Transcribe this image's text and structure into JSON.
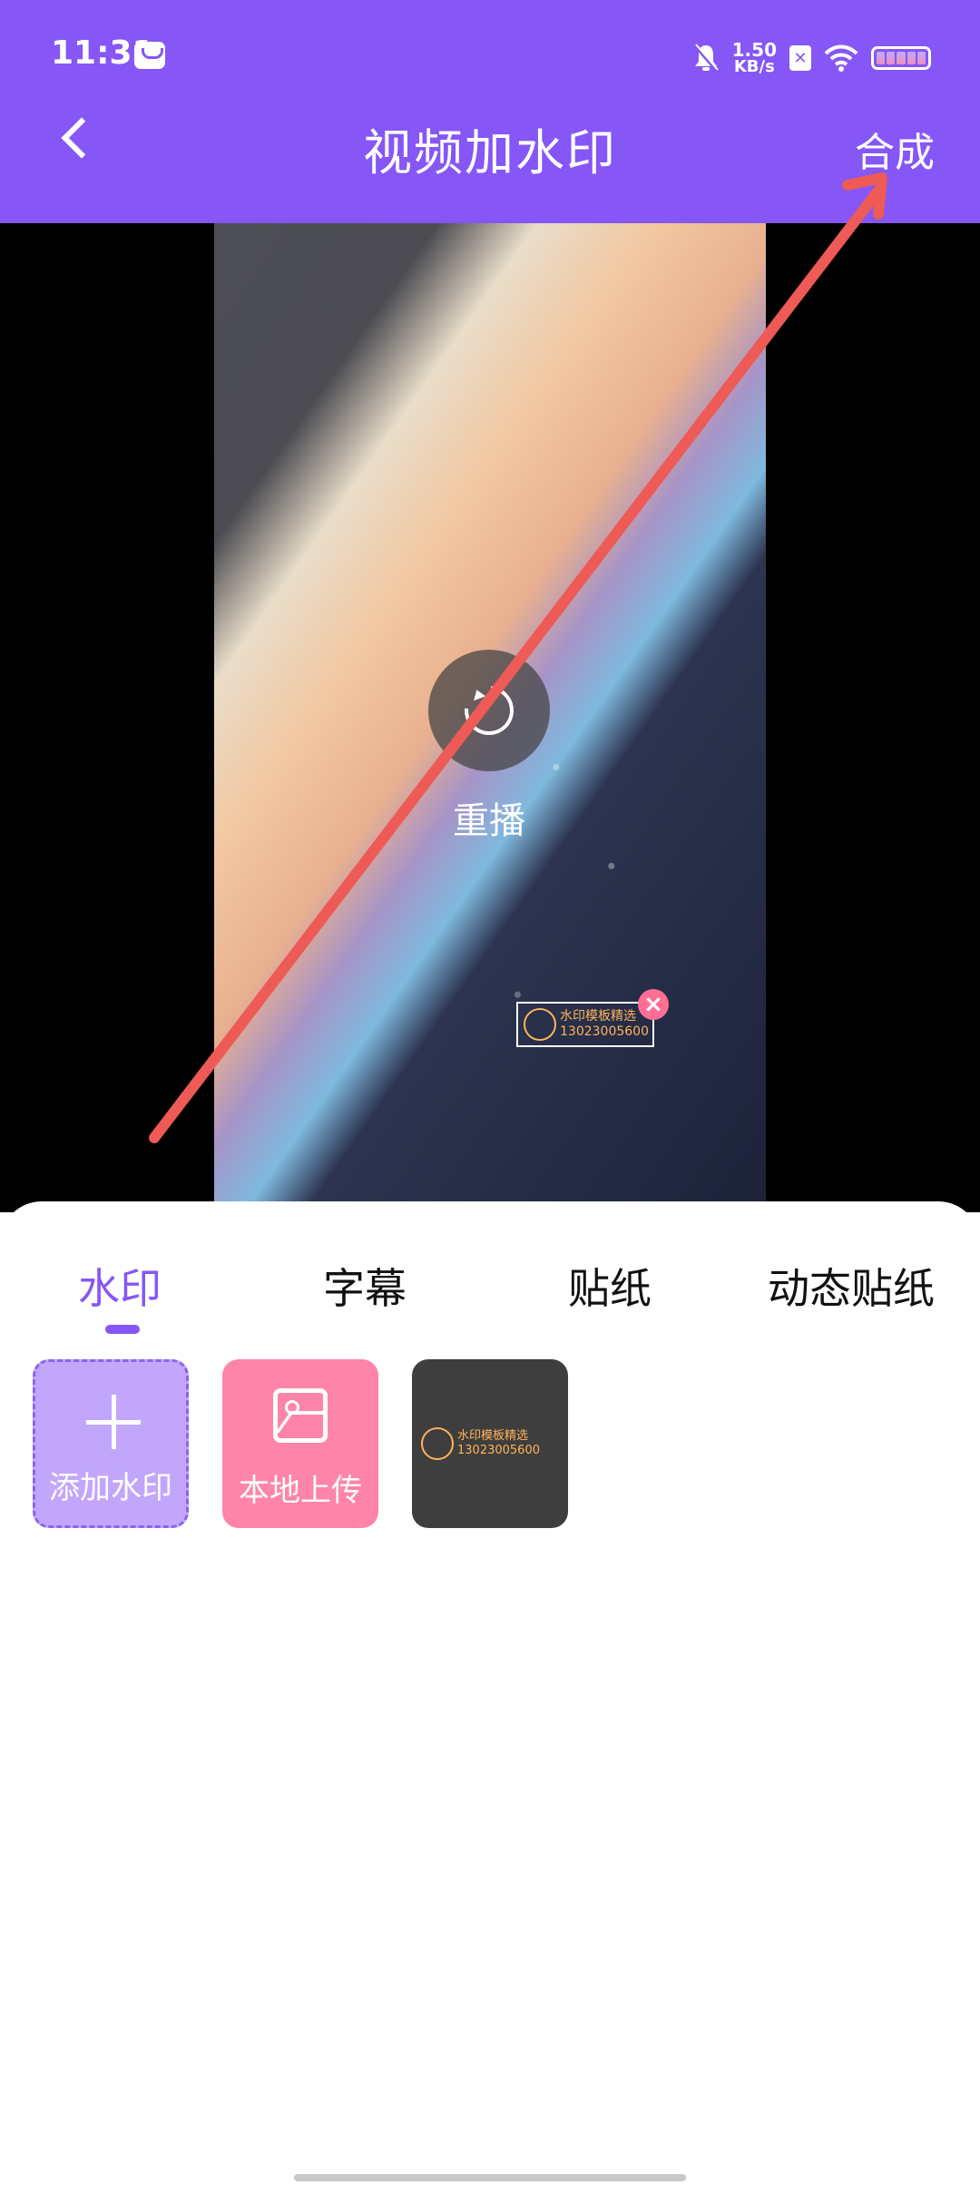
{
  "status_bar": {
    "time": "11:31",
    "net_speed_value": "1.50",
    "net_speed_unit": "KB/s",
    "icons": [
      "notification-icon",
      "mute-icon",
      "sim-x-icon",
      "wifi-icon",
      "battery-icon"
    ]
  },
  "header": {
    "title": "视频加水印",
    "right_action": "合成",
    "background": "#8656F6"
  },
  "preview": {
    "replay_label": "重播",
    "overlay_watermark": {
      "line1": "水印模板精选",
      "line2": "13023005600"
    }
  },
  "tabs": [
    {
      "label": "水印",
      "active": true
    },
    {
      "label": "字幕",
      "active": false
    },
    {
      "label": "贴纸",
      "active": false
    },
    {
      "label": "动态贴纸",
      "active": false
    }
  ],
  "tiles": [
    {
      "label": "添加水印",
      "icon": "plus-icon"
    },
    {
      "label": "本地上传",
      "icon": "image-icon"
    },
    {
      "label": "",
      "icon": "watermark-template",
      "line1": "水印模板精选",
      "line2": "13023005600"
    }
  ],
  "colors": {
    "accent": "#8656F6",
    "add_tile": "#C2A6FC",
    "upload_tile": "#FF84A9",
    "arrow": "#EE5A55"
  }
}
